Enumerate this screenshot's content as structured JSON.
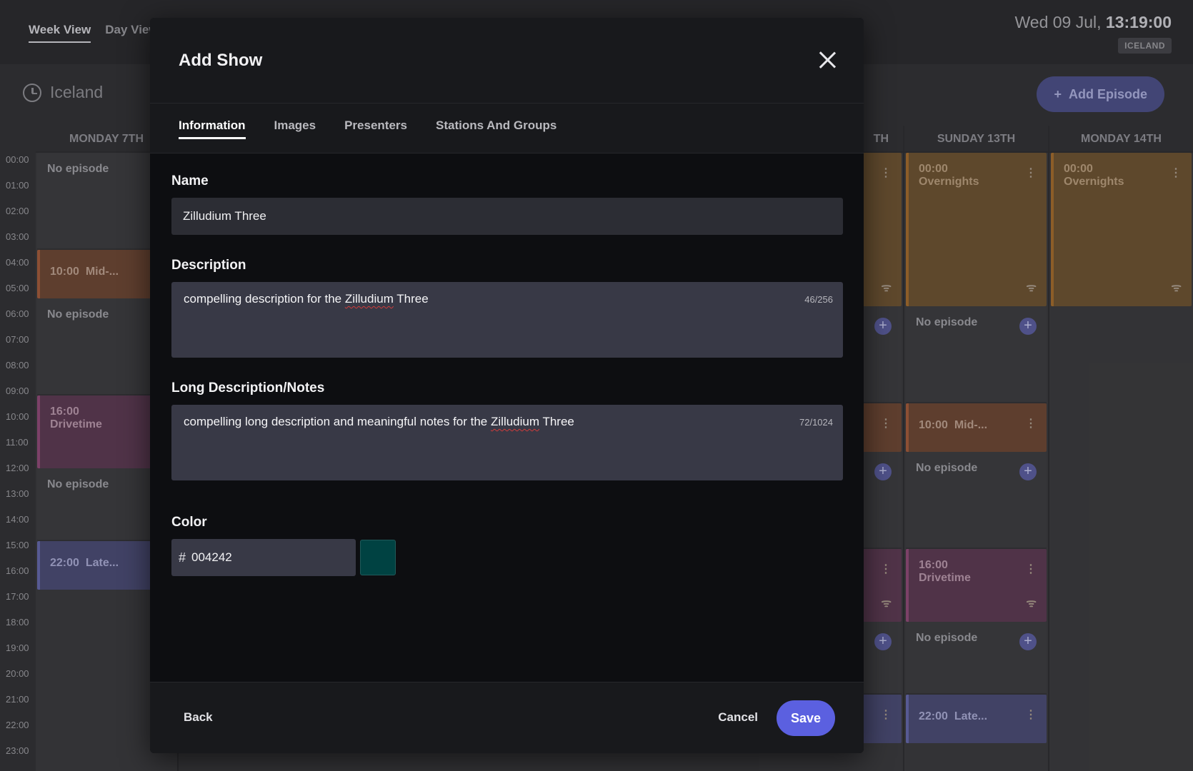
{
  "header": {
    "view_tabs": [
      "Week View",
      "Day View"
    ],
    "date": "Wed 09 Jul,",
    "time": "13:19:00",
    "timezone_badge": "ICELAND"
  },
  "toolbar": {
    "timezone": "Iceland",
    "add_episode_label": "Add Episode"
  },
  "time_labels": [
    "00:00",
    "01:00",
    "02:00",
    "03:00",
    "04:00",
    "05:00",
    "06:00",
    "07:00",
    "08:00",
    "09:00",
    "10:00",
    "11:00",
    "12:00",
    "13:00",
    "14:00",
    "15:00",
    "16:00",
    "17:00",
    "18:00",
    "19:00",
    "20:00",
    "21:00",
    "22:00",
    "23:00"
  ],
  "calendar": {
    "monday_7": {
      "header": "MONDAY 7TH",
      "slots": [
        {
          "time": "",
          "title": "No episode"
        },
        {
          "time": "10:00",
          "title": "Mid-..."
        },
        {
          "time": "",
          "title": "No episode"
        },
        {
          "time": "16:00",
          "title": "Drivetime"
        },
        {
          "time": "",
          "title": "No episode"
        },
        {
          "time": "22:00",
          "title": "Late..."
        }
      ]
    },
    "saturday_12": {
      "header_suffix": "TH"
    },
    "sunday_13": {
      "header": "SUNDAY 13TH",
      "slots": [
        {
          "time": "00:00",
          "title": "Overnights"
        },
        {
          "time": "",
          "title": "No episode"
        },
        {
          "time": "10:00",
          "title": "Mid-..."
        },
        {
          "time": "",
          "title": "No episode"
        },
        {
          "time": "16:00",
          "title": "Drivetime"
        },
        {
          "time": "",
          "title": "No episode"
        },
        {
          "time": "22:00",
          "title": "Late..."
        }
      ]
    },
    "monday_14": {
      "header": "MONDAY 14TH",
      "slots": [
        {
          "time": "00:00",
          "title": "Overnights"
        }
      ]
    }
  },
  "modal": {
    "title": "Add Show",
    "tabs": [
      "Information",
      "Images",
      "Presenters",
      "Stations And Groups"
    ],
    "name_label": "Name",
    "name_value": "Zilludium Three",
    "description_label": "Description",
    "description_prefix": "compelling description for the ",
    "description_word": "Zilludium",
    "description_suffix": " Three",
    "description_counter": "46/256",
    "long_description_label": "Long Description/Notes",
    "long_prefix": "compelling long description and meaningful notes for the ",
    "long_word": "Zilludium",
    "long_suffix": " Three",
    "long_counter": "72/1024",
    "color_label": "Color",
    "color_hash": "#",
    "color_value": "004242",
    "swatch_color": "#004242",
    "back_label": "Back",
    "cancel_label": "Cancel",
    "save_label": "Save"
  },
  "colors": {
    "accent": "#5b60e0",
    "overnights": "#6b5233",
    "drivetime": "#5c3b52",
    "late": "#4a4c74"
  }
}
